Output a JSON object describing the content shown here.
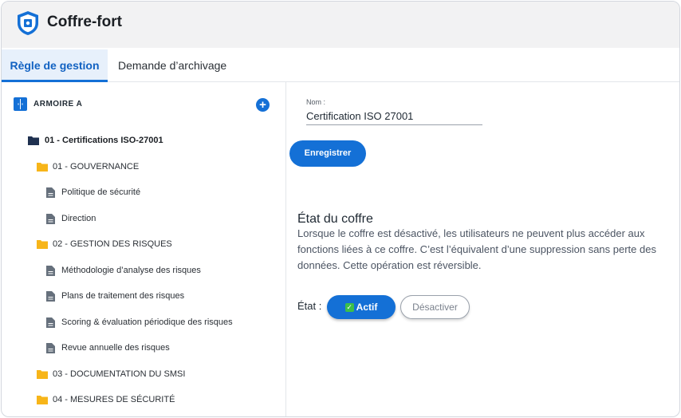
{
  "app": {
    "title": "Coffre-fort"
  },
  "tabs": [
    {
      "label": "Règle de gestion",
      "active": true
    },
    {
      "label": "Demande d’archivage",
      "active": false
    }
  ],
  "tree": {
    "armoire_label": "ARMOIRE A",
    "items": [
      {
        "label": "01 - Certifications ISO-27001",
        "type": "root-folder"
      },
      {
        "label": "01 - GOUVERNANCE",
        "type": "folder"
      },
      {
        "label": "Politique de sécurité",
        "type": "document"
      },
      {
        "label": "Direction",
        "type": "document"
      },
      {
        "label": "02 - GESTION DES RISQUES",
        "type": "folder"
      },
      {
        "label": "Méthodologie d’analyse des risques",
        "type": "document"
      },
      {
        "label": "Plans de traitement des risques",
        "type": "document"
      },
      {
        "label": "Scoring & évaluation périodique des risques",
        "type": "document"
      },
      {
        "label": "Revue annuelle des risques",
        "type": "document"
      },
      {
        "label": "03 - DOCUMENTATION DU SMSI",
        "type": "folder"
      },
      {
        "label": "04 - MESURES DE SÉCURITÉ",
        "type": "folder"
      }
    ]
  },
  "form": {
    "name_label": "Nom :",
    "name_value": "Certification ISO 27001",
    "save_label": "Enregistrer"
  },
  "etat": {
    "title": "État du coffre",
    "description": "Lorsque le coffre est désactivé, les utilisateurs ne peuvent plus accéder aux fonctions liées à ce coffre. C’est l’équivalent d’une suppression sans perte des données. Cette opération est réversible.",
    "label": "État :",
    "actif_label": "Actif",
    "desactiver_label": "Désactiver",
    "current": "Actif"
  },
  "colors": {
    "primary": "#1470d6",
    "folder": "#f7b519",
    "root_folder": "#1f3150",
    "check": "#3cbf4a"
  }
}
